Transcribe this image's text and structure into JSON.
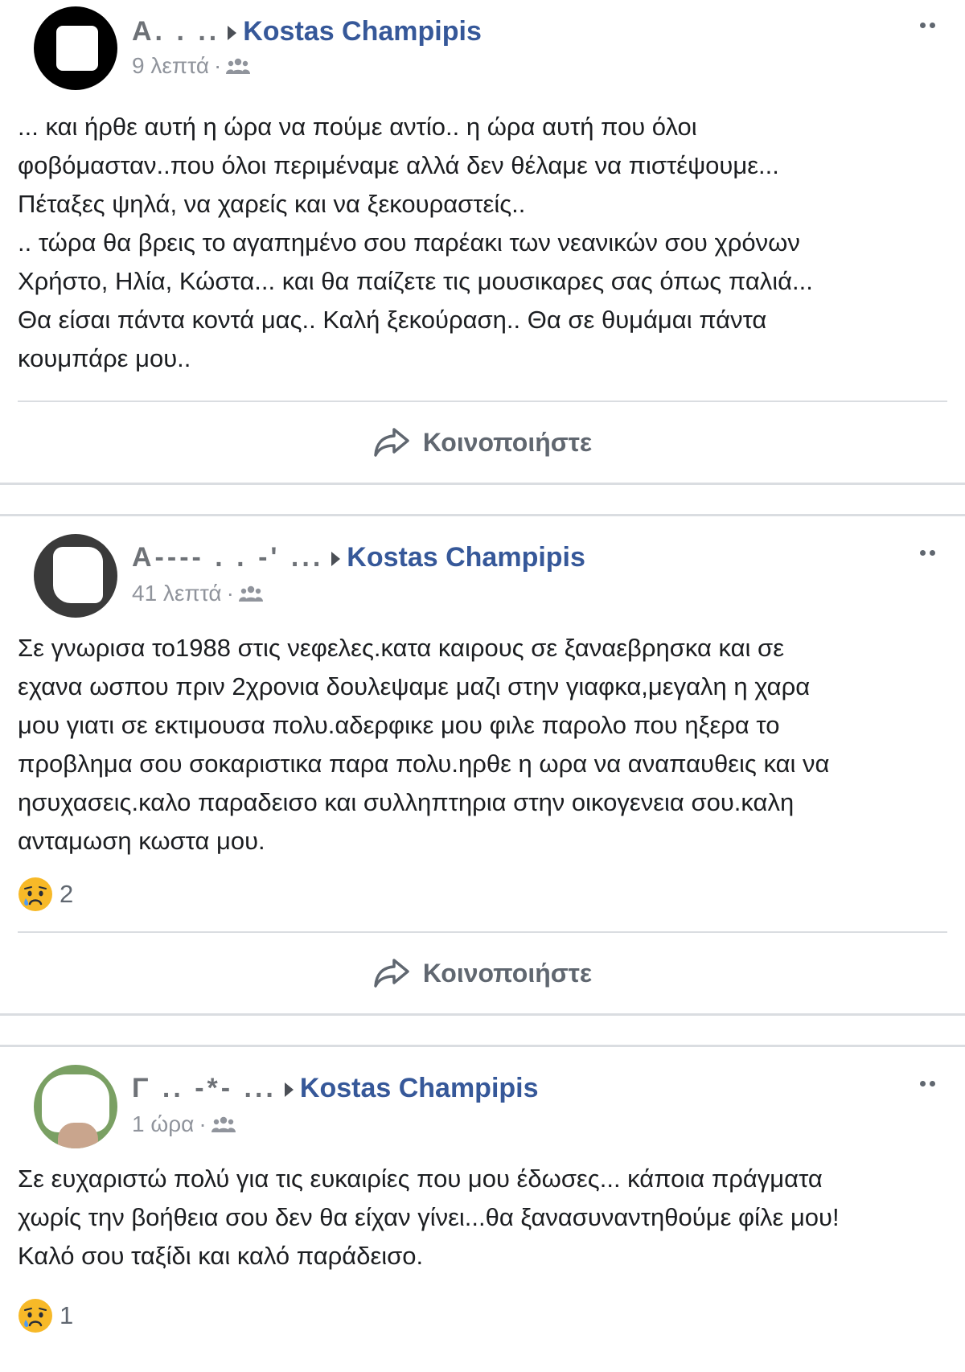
{
  "posts": [
    {
      "author_visible": "Α.      .       ..",
      "page": "Kostas Champipis",
      "time": "9 λεπτά",
      "separator": "·",
      "text": "... και ήρθε αυτή η ώρα να πούμε αντίο.. η ώρα αυτή που όλοι\nφοβόμασταν..που όλοι περιμέναμε αλλά δεν θέλαμε να πιστέψουμε...\nΠέταξες ψηλά, να χαρείς και να ξεκουραστείς..\n.. τώρα θα βρεις το αγαπημένο σου παρέακι των νεανικών σου χρόνων\nΧρήστο, Ηλία, Κώστα... και θα παίζετε τις μουσικαρες σας όπως παλιά...\nΘα είσαι πάντα κοντά μας.. Καλή ξεκούραση.. Θα σε θυμάμαι πάντα\nκουμπάρε μου..",
      "reaction_count": "",
      "share_label": "Κοινοποιήστε"
    },
    {
      "author_visible": "Α----   .  .  -'  ...",
      "page": "Kostas Champipis",
      "time": "41 λεπτά",
      "separator": "·",
      "text": "Σε γνωρισα το1988 στις νεφελες.κατα καιρους σε ξαναεβρησκα και σε\nεχανα ωσπου πριν 2χρονια δουλεψαμε μαζι στην γιαφκα,μεγαλη η χαρα\nμου γιατι σε εκτιμουσα πολυ.αδερφικε μου φιλε παρολο που ηξερα το\nπροβλημα σου σοκαριστικα παρα πολυ.ηρθε η ωρα να αναπαυθεις και να\nησυχασεις.καλο παραδεισο και συλληπτηρια στην οικογενεια σου.καλη\nανταμωση κωστα μου.",
      "reaction_count": "2",
      "share_label": "Κοινοποιήστε"
    },
    {
      "author_visible": "Γ   ..   -*-  ...",
      "page": "Kostas Champipis",
      "time": "1 ώρα",
      "separator": "·",
      "text": "Σε ευχαριστώ πολύ για τις ευκαιρίες που μου έδωσες... κάποια πράγματα\nχωρίς την βοήθεια σου δεν θα είχαν γίνει...θα ξανασυναντηθούμε φίλε μου!\nΚαλό σου ταξίδι και καλό παράδεισο.",
      "reaction_count": "1",
      "share_label": ""
    }
  ],
  "icons": {
    "group": "group-audience-icon",
    "more": "more-options-icon",
    "share": "share-arrow-icon",
    "reaction": "sad-reaction-icon"
  },
  "colors": {
    "link": "#365899",
    "meta": "#90949c",
    "divider": "#dadde1",
    "action": "#606770"
  }
}
